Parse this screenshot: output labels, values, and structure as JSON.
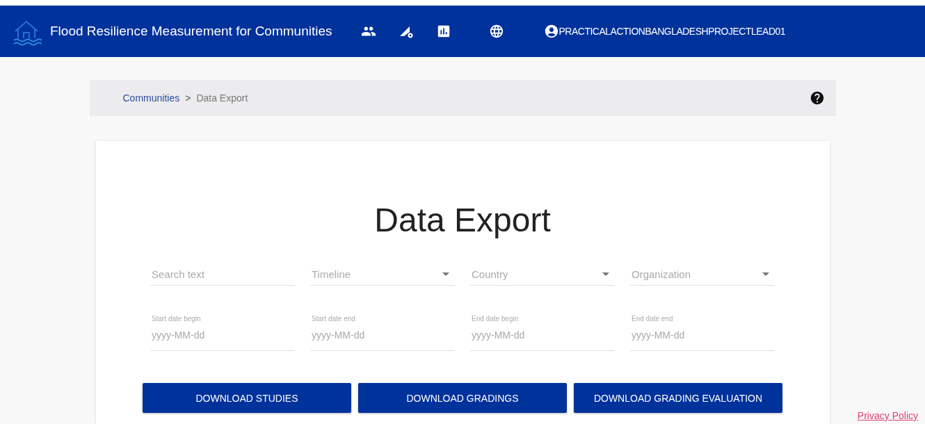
{
  "header": {
    "title": "Flood Resilience Measurement for Communities",
    "user": "PRACTICALACTIONBANGLADESHPROJECTLEAD01"
  },
  "breadcrumb": {
    "link": "Communities",
    "separator": ">",
    "current": "Data Export"
  },
  "page_title": "Data Export",
  "filters": [
    {
      "kind": "text",
      "placeholder": "Search text"
    },
    {
      "kind": "select",
      "placeholder": "Timeline"
    },
    {
      "kind": "select",
      "placeholder": "Country"
    },
    {
      "kind": "select",
      "placeholder": "Organization"
    }
  ],
  "date_fields": [
    {
      "label": "Start date begin",
      "placeholder": "yyyy-MM-dd"
    },
    {
      "label": "Start date end",
      "placeholder": "yyyy-MM-dd"
    },
    {
      "label": "End date begin",
      "placeholder": "yyyy-MM-dd"
    },
    {
      "label": "End date end",
      "placeholder": "yyyy-MM-dd"
    }
  ],
  "buttons": [
    "DOWNLOAD STUDIES",
    "DOWNLOAD GRADINGS",
    "DOWNLOAD GRADING EVALUATION"
  ],
  "footer_link": "Privacy Policy"
}
